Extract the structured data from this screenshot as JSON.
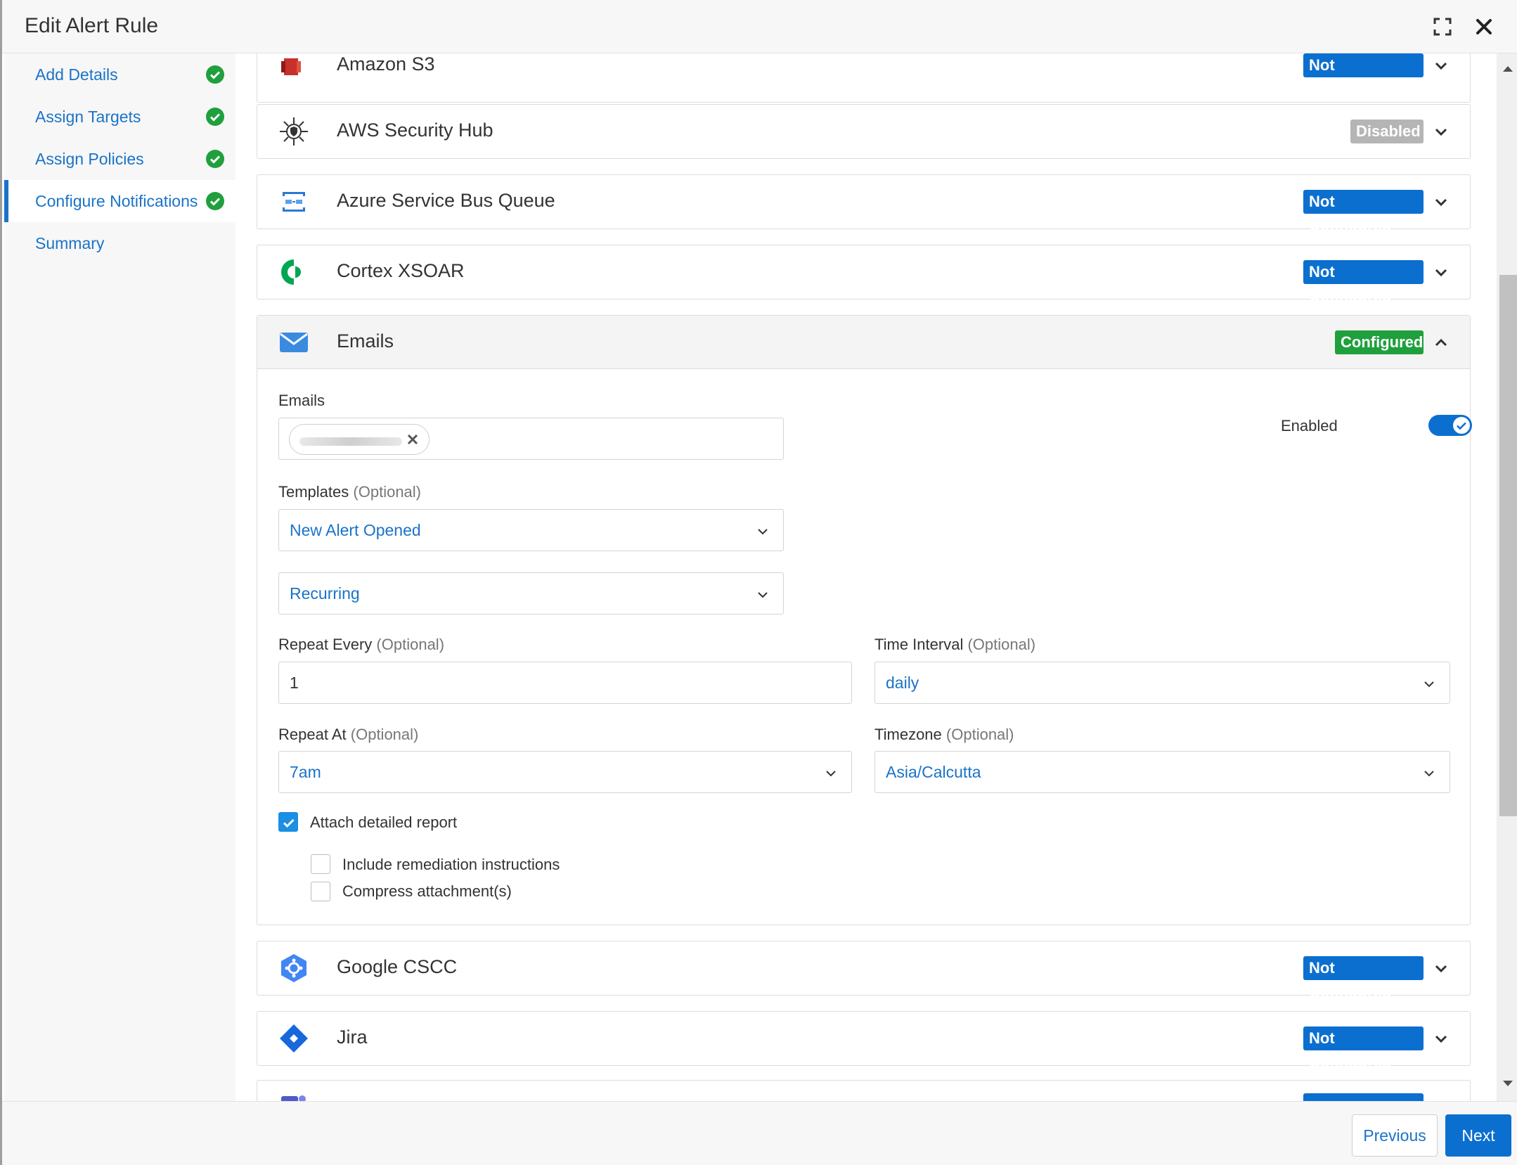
{
  "header": {
    "title": "Edit Alert Rule"
  },
  "sidebar": {
    "steps": [
      {
        "label": "Add Details"
      },
      {
        "label": "Assign Targets"
      },
      {
        "label": "Assign Policies"
      },
      {
        "label": "Configure Notifications"
      },
      {
        "label": "Summary"
      }
    ]
  },
  "integrations": [
    {
      "name": "Amazon S3",
      "status": "Not Configured"
    },
    {
      "name": "AWS Security Hub",
      "status": "Disabled"
    },
    {
      "name": "Azure Service Bus Queue",
      "status": "Not Configured"
    },
    {
      "name": "Cortex XSOAR",
      "status": "Not Configured"
    },
    {
      "name": "Emails",
      "status": "Configured"
    },
    {
      "name": "Google CSCC",
      "status": "Not Configured"
    },
    {
      "name": "Jira",
      "status": "Not Configured"
    }
  ],
  "emails_panel": {
    "emails_label": "Emails",
    "enabled_label": "Enabled",
    "enabled": true,
    "templates_label": "Templates",
    "optional": "(Optional)",
    "template_value": "New Alert Opened",
    "frequency_value": "Recurring",
    "repeat_every_label": "Repeat Every",
    "repeat_every_value": "1",
    "time_interval_label": "Time Interval",
    "time_interval_value": "daily",
    "repeat_at_label": "Repeat At",
    "repeat_at_value": "7am",
    "timezone_label": "Timezone",
    "timezone_value": "Asia/Calcutta",
    "attach_report_label": "Attach detailed report",
    "attach_report_checked": true,
    "include_remediation_label": "Include remediation instructions",
    "include_remediation_checked": false,
    "compress_label": "Compress attachment(s)",
    "compress_checked": false
  },
  "footer": {
    "previous_label": "Previous",
    "next_label": "Next"
  },
  "colors": {
    "primary": "#0b6fd0",
    "success": "#1fa03c",
    "disabled": "#b5b5b5",
    "link": "#1a73c8"
  }
}
